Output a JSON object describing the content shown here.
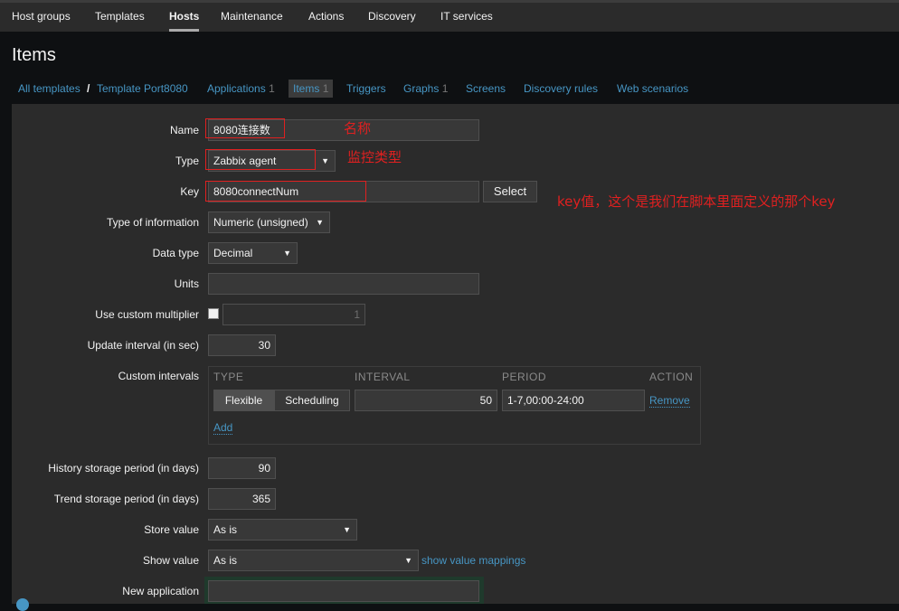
{
  "top_nav": {
    "tabs": [
      {
        "label": "Host groups"
      },
      {
        "label": "Templates"
      },
      {
        "label": "Hosts",
        "active": true
      },
      {
        "label": "Maintenance"
      },
      {
        "label": "Actions"
      },
      {
        "label": "Discovery"
      },
      {
        "label": "IT services"
      }
    ]
  },
  "page_title": "Items",
  "sub_nav": {
    "all_templates": "All templates",
    "separator": "/",
    "template": "Template Port8080",
    "applications": {
      "label": "Applications",
      "count": "1"
    },
    "items": {
      "label": "Items",
      "count": "1"
    },
    "triggers": "Triggers",
    "graphs": {
      "label": "Graphs",
      "count": "1"
    },
    "screens": "Screens",
    "discovery_rules": "Discovery rules",
    "web_scenarios": "Web scenarios"
  },
  "form": {
    "name": {
      "label": "Name",
      "value": "8080连接数",
      "annotation": "名称"
    },
    "type": {
      "label": "Type",
      "value": "Zabbix agent",
      "annotation": "监控类型"
    },
    "key": {
      "label": "Key",
      "value": "8080connectNum",
      "select_button": "Select",
      "annotation": "key值，这个是我们在脚本里面定义的那个key"
    },
    "type_of_information": {
      "label": "Type of information",
      "value": "Numeric (unsigned)"
    },
    "data_type": {
      "label": "Data type",
      "value": "Decimal"
    },
    "units": {
      "label": "Units",
      "value": ""
    },
    "custom_multiplier": {
      "label": "Use custom multiplier",
      "checked": false,
      "value": "1"
    },
    "update_interval": {
      "label": "Update interval (in sec)",
      "value": "30"
    },
    "custom_intervals": {
      "label": "Custom intervals",
      "headers": {
        "type": "TYPE",
        "interval": "INTERVAL",
        "period": "PERIOD",
        "action": "ACTION"
      },
      "row": {
        "flexible": "Flexible",
        "scheduling": "Scheduling",
        "interval": "50",
        "period": "1-7,00:00-24:00",
        "remove": "Remove"
      },
      "add": "Add"
    },
    "history": {
      "label": "History storage period (in days)",
      "value": "90"
    },
    "trends": {
      "label": "Trend storage period (in days)",
      "value": "365"
    },
    "store_value": {
      "label": "Store value",
      "value": "As is"
    },
    "show_value": {
      "label": "Show value",
      "value": "As is",
      "mappings_link": "show value mappings"
    },
    "new_application": {
      "label": "New application",
      "value": ""
    }
  }
}
